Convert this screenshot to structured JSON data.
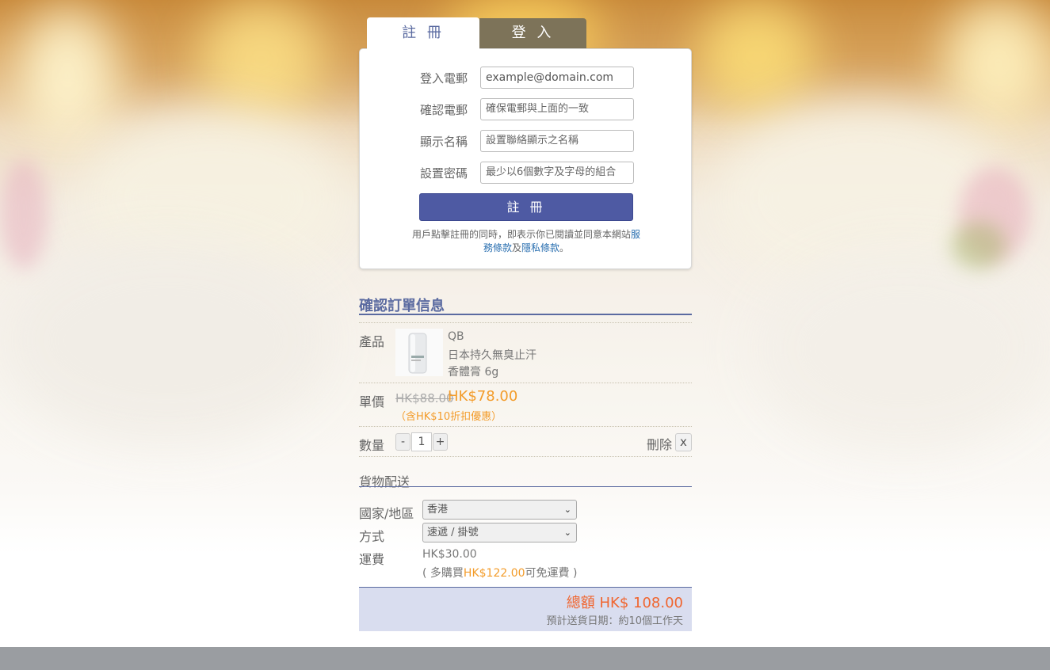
{
  "tabs": {
    "register": "註 冊",
    "login": "登 入"
  },
  "form": {
    "email_label": "登入電郵",
    "email_value": "example@domain.com",
    "confirm_label": "確認電郵",
    "confirm_placeholder": "確保電郵與上面的一致",
    "name_label": "顯示名稱",
    "name_placeholder": "設置聯絡顯示之名稱",
    "password_label": "設置密碼",
    "password_placeholder": "最少以6個數字及字母的組合",
    "submit_label": "註 冊",
    "note_prefix": "用戶點擊註冊的同時，即表示你已閱讀並同意本網站",
    "terms_link": "服務條款",
    "note_and": "及",
    "privacy_link": "隱私條款",
    "note_suffix": "。"
  },
  "order": {
    "title": "確認訂單信息",
    "product_label": "產品",
    "product_brand": "QB",
    "product_name_line1": "日本持久無臭止汗",
    "product_name_line2": "香體膏 6g",
    "unit_price_label": "單價",
    "old_price": "HK$88.00",
    "new_price": "HK$78.00",
    "discount_note": "（含HK$10折扣優惠）",
    "quantity_label": "數量",
    "qty_minus": "-",
    "qty_value": "1",
    "qty_plus": "+",
    "delete_label": "刪除",
    "delete_x": "x"
  },
  "shipping": {
    "title": "貨物配送",
    "country_label": "國家/地區",
    "country_value": "香港",
    "method_label": "方式",
    "method_value": "速遞 / 掛號",
    "fee_label": "運費",
    "fee_value": "HK$30.00",
    "free_prefix": "( 多購買",
    "free_amount": "HK$122.00",
    "free_suffix": "可免運費 )"
  },
  "summary": {
    "total": "總額 HK$ 108.00",
    "eta": "預計送貨日期：約10個工作天"
  },
  "colors": {
    "accent": "#4e5aa3",
    "price": "#f39c2a",
    "total": "#f0652f",
    "login_tab": "#7d7359"
  }
}
